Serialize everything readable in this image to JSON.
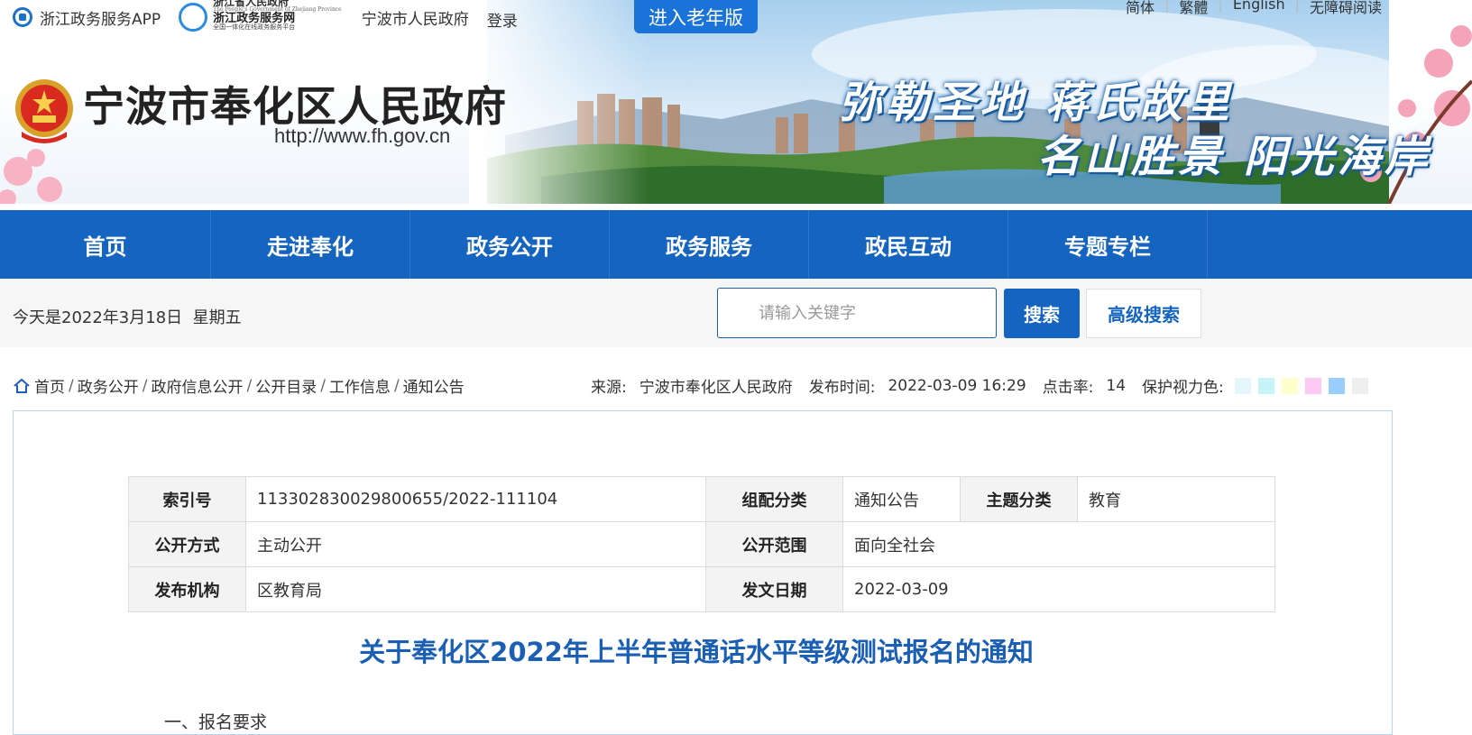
{
  "top_links": {
    "app_label": "浙江政务服务APP",
    "zw_line1": "浙江省人民政府",
    "zw_line2": "The People's Government of Zhejiang Province",
    "zw_line3": "浙江政务服务网",
    "zw_line4": "全国一体化在线政务服务平台",
    "city_gov": "宁波市人民政府",
    "login": "登录"
  },
  "elder_button": "进入老年版",
  "languages": [
    "简体",
    "繁體",
    "English",
    "无障碍阅读"
  ],
  "site": {
    "title": "宁波市奉化区人民政府",
    "url": "http://www.fh.gov.cn",
    "slogan_line1": "弥勒圣地 蒋氏故里",
    "slogan_line2": "名山胜景 阳光海岸"
  },
  "nav": [
    "首页",
    "走进奉化",
    "政务公开",
    "政务服务",
    "政民互动",
    "专题专栏"
  ],
  "date_text": "今天是2022年3月18日  星期五",
  "search": {
    "placeholder": "请输入关键字",
    "button": "搜索",
    "advanced": "高级搜索"
  },
  "breadcrumb": [
    "首页",
    "政务公开",
    "政府信息公开",
    "公开目录",
    "工作信息",
    "通知公告"
  ],
  "meta": {
    "source_label": "来源:",
    "source": "宁波市奉化区人民政府",
    "time_label": "发布时间:",
    "time": "2022-03-09 16:29",
    "hits_label": "点击率:",
    "hits": "14",
    "color_label": "保护视力色:",
    "colors": [
      "#e6f7fb",
      "#c6f3f8",
      "#ffffcc",
      "#ffc9f5",
      "#99ccff",
      "#eeeeee"
    ]
  },
  "info_table": {
    "index_label": "索引号",
    "index": "11330283002980065 5/2022-111104",
    "group_label": "组配分类",
    "group": "通知公告",
    "topic_label": "主题分类",
    "topic": "教育",
    "open_mode_label": "公开方式",
    "open_mode": "主动公开",
    "open_scope_label": "公开范围",
    "open_scope": "面向全社会",
    "org_label": "发布机构",
    "org": "区教育局",
    "date_label": "发文日期",
    "date": "2022-03-09"
  },
  "doc_title": "关于奉化区2022年上半年普通话水平等级测试报名的通知",
  "section_1": "一、报名要求"
}
